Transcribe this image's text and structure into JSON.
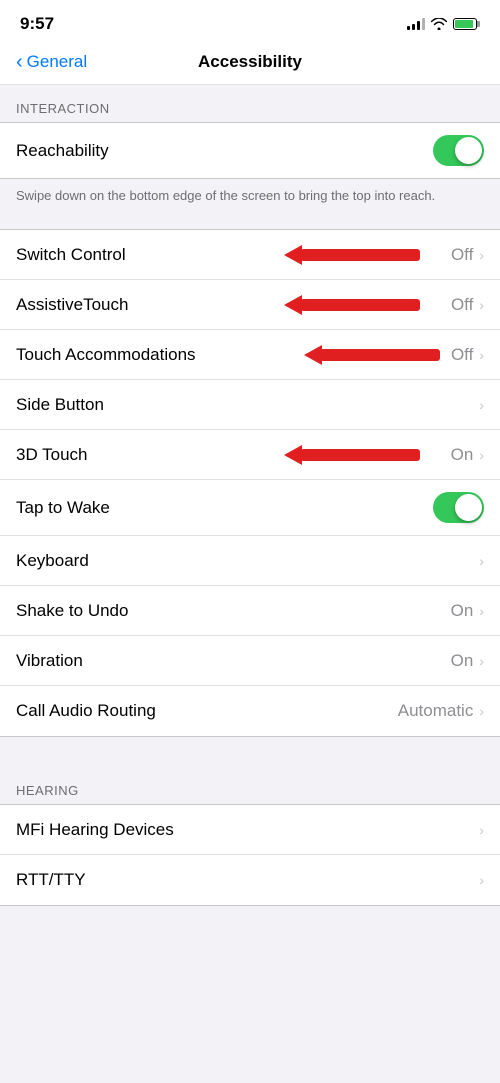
{
  "statusBar": {
    "time": "9:57"
  },
  "navBar": {
    "backLabel": "General",
    "title": "Accessibility"
  },
  "sections": {
    "interaction": {
      "header": "INTERACTION",
      "items": [
        {
          "id": "reachability",
          "label": "Reachability",
          "type": "toggle",
          "value": true,
          "hasArrow": false,
          "showValue": false
        },
        {
          "id": "reachability-desc",
          "type": "description",
          "text": "Swipe down on the bottom edge of the screen to bring the top into reach."
        },
        {
          "id": "switch-control",
          "label": "Switch Control",
          "type": "nav",
          "value": "Off",
          "hasArrow": true,
          "redArrow": true
        },
        {
          "id": "assistive-touch",
          "label": "AssistiveTouch",
          "type": "nav",
          "value": "Off",
          "hasArrow": true,
          "redArrow": true
        },
        {
          "id": "touch-accommodations",
          "label": "Touch Accommodations",
          "type": "nav",
          "value": "Off",
          "hasArrow": true,
          "redArrow": true
        },
        {
          "id": "side-button",
          "label": "Side Button",
          "type": "nav",
          "value": "",
          "hasArrow": true,
          "redArrow": false
        },
        {
          "id": "3d-touch",
          "label": "3D Touch",
          "type": "nav",
          "value": "On",
          "hasArrow": true,
          "redArrow": true
        },
        {
          "id": "tap-to-wake",
          "label": "Tap to Wake",
          "type": "toggle",
          "value": true,
          "hasArrow": false,
          "showValue": false,
          "redArrow": false
        },
        {
          "id": "keyboard",
          "label": "Keyboard",
          "type": "nav",
          "value": "",
          "hasArrow": true,
          "redArrow": false
        },
        {
          "id": "shake-to-undo",
          "label": "Shake to Undo",
          "type": "nav",
          "value": "On",
          "hasArrow": true,
          "redArrow": false
        },
        {
          "id": "vibration",
          "label": "Vibration",
          "type": "nav",
          "value": "On",
          "hasArrow": true,
          "redArrow": false
        },
        {
          "id": "call-audio-routing",
          "label": "Call Audio Routing",
          "type": "nav",
          "value": "Automatic",
          "hasArrow": true,
          "redArrow": false
        }
      ]
    },
    "hearing": {
      "header": "HEARING",
      "items": [
        {
          "id": "mfi-hearing",
          "label": "MFi Hearing Devices",
          "type": "nav",
          "value": "",
          "hasArrow": true,
          "redArrow": false
        },
        {
          "id": "rtt-tty",
          "label": "RTT/TTY",
          "type": "nav",
          "value": "",
          "hasArrow": true,
          "redArrow": false
        }
      ]
    }
  }
}
